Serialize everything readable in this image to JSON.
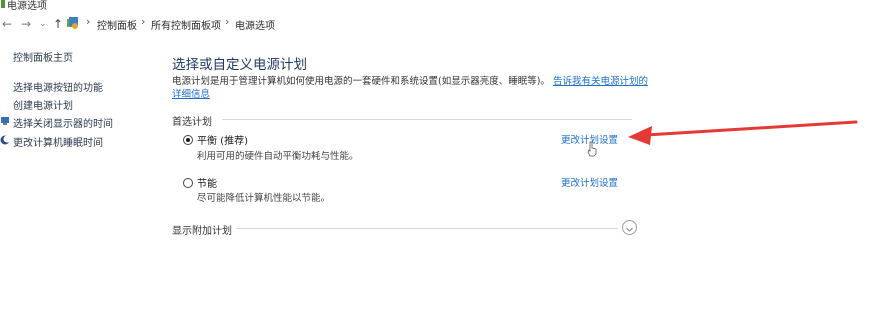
{
  "window": {
    "title": "电源选项"
  },
  "address_bar": {
    "back_icon": "back-arrow-icon",
    "forward_icon": "forward-arrow-icon",
    "recent_icon": "chevron-down-icon",
    "up_icon": "up-arrow-icon",
    "breadcrumbs": [
      "控制面板",
      "所有控制面板项",
      "电源选项"
    ]
  },
  "sidebar": {
    "home": "控制面板主页",
    "items": [
      {
        "label": "选择电源按钮的功能",
        "icon": null
      },
      {
        "label": "创建电源计划",
        "icon": null
      },
      {
        "label": "选择关闭显示器的时间",
        "icon": "monitor-icon"
      },
      {
        "label": "更改计算机睡眠时间",
        "icon": "moon-icon"
      }
    ]
  },
  "main": {
    "heading": "选择或自定义电源计划",
    "description_text": "电源计划是用于管理计算机如何使用电源的一套硬件和系统设置(如显示器亮度、睡眠等)。",
    "description_link": "告诉我有关电源计划的详细信息",
    "preferred_label": "首选计划",
    "plans": [
      {
        "name": "平衡 (推荐)",
        "desc": "利用可用的硬件自动平衡功耗与性能。",
        "link": "更改计划设置",
        "selected": true
      },
      {
        "name": "节能",
        "desc": "尽可能降低计算机性能以节能。",
        "link": "更改计划设置",
        "selected": false
      }
    ],
    "additional_plans_label": "显示附加计划",
    "expand_icon": "chevron-down-icon"
  },
  "colors": {
    "link": "#1f6fc5",
    "heading": "#1f3a5f",
    "annotation_arrow": "#e53935"
  }
}
